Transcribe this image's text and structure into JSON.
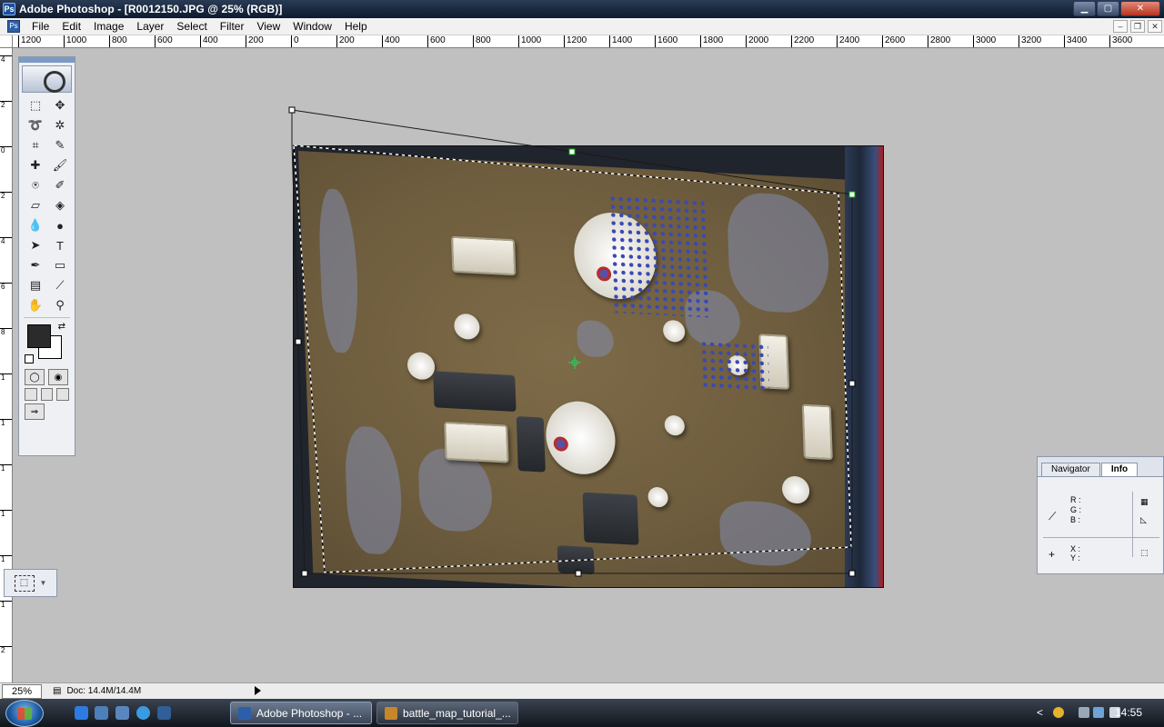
{
  "window": {
    "title": "Adobe Photoshop - [R0012150.JPG @ 25% (RGB)]",
    "min_label": "▁",
    "max_label": "▢",
    "close_label": "✕"
  },
  "menu": {
    "items": [
      "File",
      "Edit",
      "Image",
      "Layer",
      "Select",
      "Filter",
      "View",
      "Window",
      "Help"
    ]
  },
  "ruler": {
    "h_labels": [
      "1200",
      "1000",
      "800",
      "600",
      "400",
      "200",
      "0",
      "200",
      "400",
      "600",
      "800",
      "1000",
      "1200",
      "1400",
      "1600",
      "1800",
      "2000",
      "2200",
      "2400",
      "2600",
      "2800",
      "3000",
      "3200",
      "3400",
      "3600"
    ],
    "v_labels": [
      "4",
      "2",
      "0",
      "2",
      "4",
      "6",
      "8",
      "1",
      "1",
      "1",
      "1",
      "1",
      "1",
      "2",
      "2"
    ]
  },
  "toolbox": {
    "tools": [
      {
        "name": "marquee-tool-icon",
        "glyph": "⬚"
      },
      {
        "name": "move-tool-icon",
        "glyph": "✥"
      },
      {
        "name": "lasso-tool-icon",
        "glyph": "➰"
      },
      {
        "name": "magic-wand-tool-icon",
        "glyph": "✲"
      },
      {
        "name": "crop-tool-icon",
        "glyph": "⌗"
      },
      {
        "name": "slice-tool-icon",
        "glyph": "✎"
      },
      {
        "name": "healing-brush-tool-icon",
        "glyph": "✚"
      },
      {
        "name": "brush-tool-icon",
        "glyph": "🖌"
      },
      {
        "name": "clone-stamp-tool-icon",
        "glyph": "⍟"
      },
      {
        "name": "history-brush-tool-icon",
        "glyph": "✐"
      },
      {
        "name": "eraser-tool-icon",
        "glyph": "▱"
      },
      {
        "name": "paint-bucket-tool-icon",
        "glyph": "◈"
      },
      {
        "name": "blur-tool-icon",
        "glyph": "💧"
      },
      {
        "name": "dodge-tool-icon",
        "glyph": "●"
      },
      {
        "name": "path-selection-tool-icon",
        "glyph": "➤"
      },
      {
        "name": "type-tool-icon",
        "glyph": "T"
      },
      {
        "name": "pen-tool-icon",
        "glyph": "✒"
      },
      {
        "name": "shape-tool-icon",
        "glyph": "▭"
      },
      {
        "name": "notes-tool-icon",
        "glyph": "▤"
      },
      {
        "name": "eyedropper-tool-icon",
        "glyph": "⟋"
      },
      {
        "name": "hand-tool-icon",
        "glyph": "✋"
      },
      {
        "name": "zoom-tool-icon",
        "glyph": "⚲"
      }
    ],
    "swap_glyph": "⇄"
  },
  "info_panel": {
    "tabs": [
      "Navigator",
      "Info"
    ],
    "r_label": "R :",
    "g_label": "G :",
    "b_label": "B :",
    "x_label": "X :",
    "y_label": "Y :"
  },
  "status": {
    "zoom": "25%",
    "doc": "Doc: 14.4M/14.4M"
  },
  "taskbar": {
    "tasks": [
      "Adobe Photoshop - ...",
      "battle_map_tutorial_..."
    ],
    "clock": "14:55",
    "tray_caret": "<"
  },
  "colors": {
    "foreground": "#2b2b2b",
    "background": "#ffffff",
    "workspace": "#c0c0c0"
  }
}
